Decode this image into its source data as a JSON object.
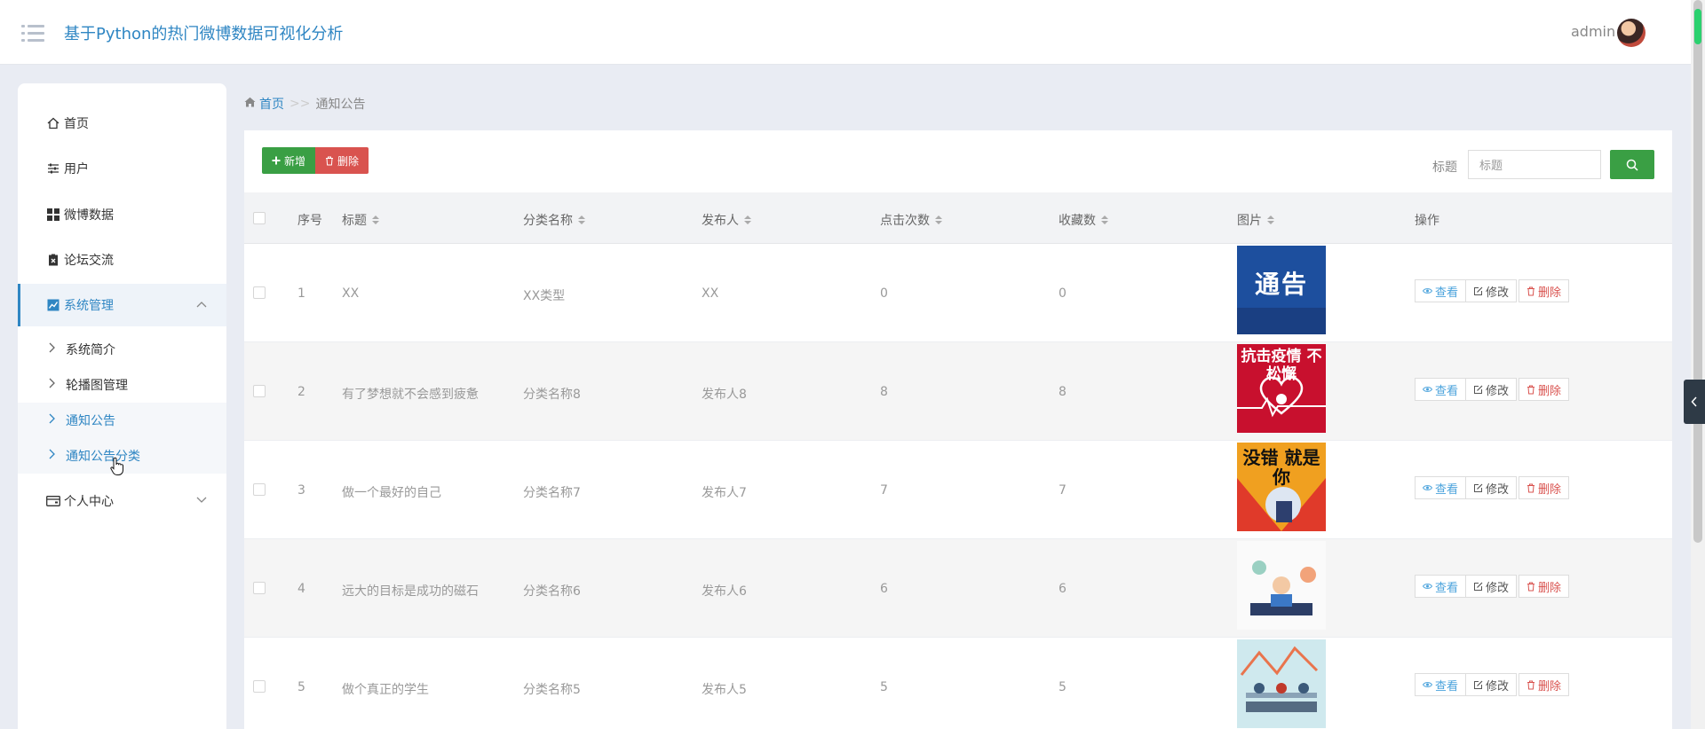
{
  "header": {
    "title": "基于Python的热门微博数据可视化分析",
    "user": "admin",
    "menu_icon": "list-icon",
    "avatar_icon": "avatar"
  },
  "sidebar": {
    "items": [
      {
        "label": "首页",
        "icon": "home-icon"
      },
      {
        "label": "用户",
        "icon": "sliders-icon"
      },
      {
        "label": "微博数据",
        "icon": "grid-icon"
      },
      {
        "label": "论坛交流",
        "icon": "clipboard-icon"
      },
      {
        "label": "系统管理",
        "icon": "chart-icon",
        "expanded": true
      },
      {
        "label": "个人中心",
        "icon": "card-icon",
        "expanded": false
      }
    ],
    "sub_items": [
      {
        "label": "系统简介"
      },
      {
        "label": "轮播图管理"
      },
      {
        "label": "通知公告"
      },
      {
        "label": "通知公告分类"
      }
    ]
  },
  "breadcrumb": {
    "home": "首页",
    "separator": ">>",
    "current": "通知公告"
  },
  "toolbar": {
    "add_label": "新增",
    "delete_label": "删除",
    "search_label": "标题",
    "search_placeholder": "标题"
  },
  "table": {
    "columns": [
      "序号",
      "标题",
      "分类名称",
      "发布人",
      "点击次数",
      "收藏数",
      "图片",
      "操作"
    ],
    "rows": [
      {
        "idx": "1",
        "title": "XX",
        "category": "XX类型",
        "publisher": "XX",
        "clicks": "0",
        "favorites": "0",
        "image_text": "通告"
      },
      {
        "idx": "2",
        "title": "有了梦想就不会感到疲惫",
        "category": "分类名称8",
        "publisher": "发布人8",
        "clicks": "8",
        "favorites": "8",
        "image_text": "抗击疫情 不松懈"
      },
      {
        "idx": "3",
        "title": "做一个最好的自己",
        "category": "分类名称7",
        "publisher": "发布人7",
        "clicks": "7",
        "favorites": "7",
        "image_text": "没错 就是你"
      },
      {
        "idx": "4",
        "title": "远大的目标是成功的磁石",
        "category": "分类名称6",
        "publisher": "发布人6",
        "clicks": "6",
        "favorites": "6",
        "image_text": ""
      },
      {
        "idx": "5",
        "title": "做个真正的学生",
        "category": "分类名称5",
        "publisher": "发布人5",
        "clicks": "5",
        "favorites": "5",
        "image_text": ""
      }
    ],
    "actions": {
      "view": "查看",
      "edit": "修改",
      "delete": "删除"
    }
  },
  "colors": {
    "primary": "#2f86c3",
    "success": "#3a9f44",
    "danger": "#d9534f",
    "background": "#e9ecf3"
  }
}
